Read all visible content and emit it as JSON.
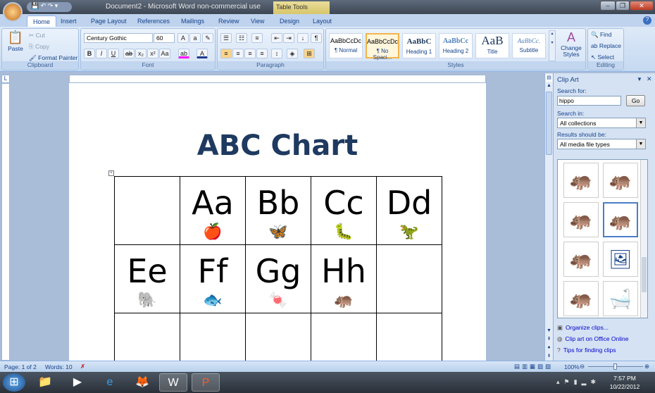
{
  "window": {
    "title": "Document2 - Microsoft Word non-commercial use",
    "context_tab": "Table Tools",
    "minimize": "–",
    "maximize": "❐",
    "close": "✕"
  },
  "tabs": [
    "Home",
    "Insert",
    "Page Layout",
    "References",
    "Mailings",
    "Review",
    "View",
    "Design",
    "Layout"
  ],
  "ribbon": {
    "clipboard": {
      "label": "Clipboard",
      "paste": "Paste",
      "cut": "Cut",
      "copy": "Copy",
      "format_painter": "Format Painter"
    },
    "font": {
      "label": "Font",
      "name": "Century Gothic",
      "size": "60"
    },
    "paragraph": {
      "label": "Paragraph"
    },
    "styles": {
      "label": "Styles",
      "items": [
        {
          "preview": "AaBbCcDc",
          "name": "¶ Normal"
        },
        {
          "preview": "AaBbCcDc",
          "name": "¶ No Spaci..."
        },
        {
          "preview": "AaBbC",
          "name": "Heading 1"
        },
        {
          "preview": "AaBbCc",
          "name": "Heading 2"
        },
        {
          "preview": "AaB",
          "name": "Title"
        },
        {
          "preview": "AaBbCc.",
          "name": "Subtitle"
        }
      ],
      "change_styles": "Change Styles"
    },
    "editing": {
      "label": "Editing",
      "find": "Find",
      "replace": "Replace",
      "select": "Select"
    }
  },
  "document": {
    "title": "ABC Chart",
    "rows": [
      [
        {
          "text": "",
          "pic": ""
        },
        {
          "text": "Aa",
          "pic": "🍎"
        },
        {
          "text": "Bb",
          "pic": "🦋"
        },
        {
          "text": "Cc",
          "pic": "🐛"
        },
        {
          "text": "Dd",
          "pic": "🦖"
        }
      ],
      [
        {
          "text": "Ee",
          "pic": "🐘"
        },
        {
          "text": "Ff",
          "pic": "🐟"
        },
        {
          "text": "Gg",
          "pic": "🍬"
        },
        {
          "text": "Hh",
          "pic": "🦛"
        },
        {
          "text": "",
          "pic": ""
        }
      ],
      [
        {
          "text": "",
          "pic": ""
        },
        {
          "text": "",
          "pic": ""
        },
        {
          "text": "",
          "pic": ""
        },
        {
          "text": "",
          "pic": ""
        },
        {
          "text": "",
          "pic": ""
        }
      ]
    ]
  },
  "clip_art": {
    "title": "Clip Art",
    "search_for_label": "Search for:",
    "search_value": "hippo",
    "go": "Go",
    "search_in_label": "Search in:",
    "search_in": "All collections",
    "results_label": "Results should be:",
    "results_type": "All media file types",
    "results": [
      "🦛",
      "🦛",
      "🦛",
      "🦛",
      "🦛",
      "🖼",
      "🦛",
      "🛁"
    ],
    "links": [
      "Organize clips...",
      "Clip art on Office Online",
      "Tips for finding clips"
    ]
  },
  "status": {
    "page": "Page: 1 of 2",
    "words": "Words: 10",
    "zoom": "100%"
  },
  "taskbar": {
    "time": "7:57 PM",
    "date": "10/22/2012"
  }
}
